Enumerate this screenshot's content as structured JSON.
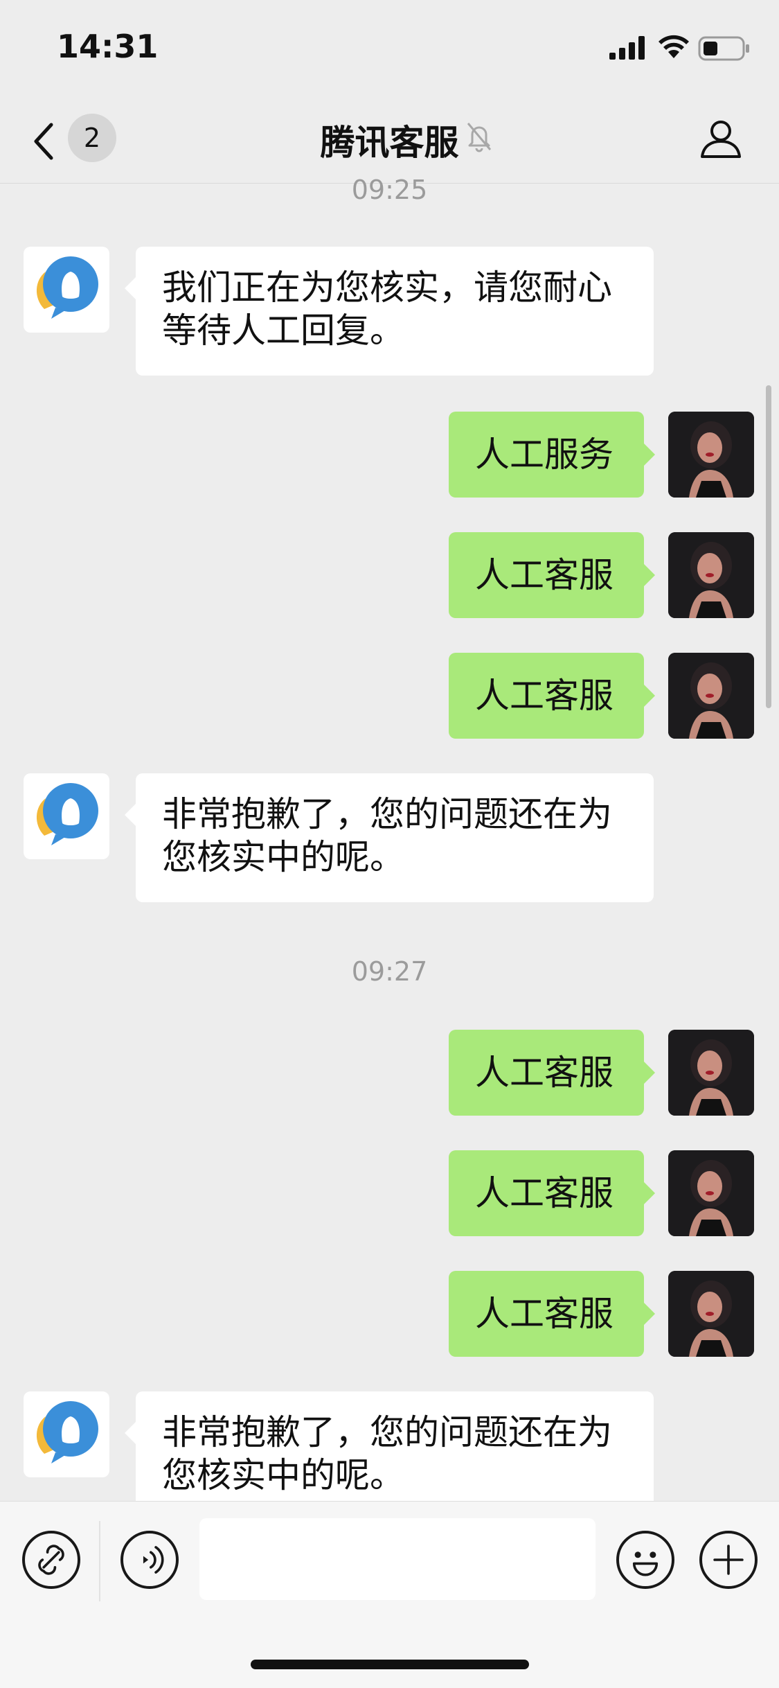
{
  "status_bar": {
    "time": "14:31"
  },
  "nav": {
    "unread_count": "2",
    "title": "腾讯客服"
  },
  "timestamps": [
    "09:25",
    "09:27"
  ],
  "messages": [
    {
      "side": "in",
      "text": "我们正在为您核实，请您耐心\n等待人工回复。"
    },
    {
      "side": "out",
      "text": "人工服务"
    },
    {
      "side": "out",
      "text": "人工客服"
    },
    {
      "side": "out",
      "text": "人工客服"
    },
    {
      "side": "in",
      "text": "非常抱歉了，您的问题还在为\n您核实中的呢。"
    },
    {
      "side": "out",
      "text": "人工客服"
    },
    {
      "side": "out",
      "text": "人工客服"
    },
    {
      "side": "out",
      "text": "人工客服"
    },
    {
      "side": "in",
      "text": "非常抱歉了，您的问题还在为\n您核实中的呢。"
    }
  ],
  "icons": {
    "service_avatar": "qq-service-logo-icon",
    "user_avatar": "user-photo",
    "back": "chevron-left-icon",
    "mute": "bell-slash-icon",
    "profile": "person-icon",
    "mini_program": "link-icon",
    "voice": "voice-icon",
    "emoji": "emoji-icon",
    "more": "plus-icon"
  },
  "colors": {
    "outgoing_bubble": "#a9e97a",
    "incoming_bubble": "#ffffff",
    "background": "#ededed"
  }
}
